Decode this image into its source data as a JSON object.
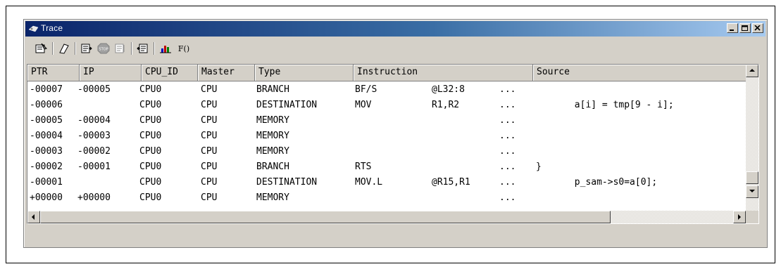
{
  "window": {
    "title": "Trace"
  },
  "toolbar": {
    "buttons": [
      "properties-icon",
      "clear-icon",
      "acquisition-icon",
      "stop-icon",
      "trace-find-icon",
      "save-icon",
      "statistics-icon",
      "function-call-icon"
    ],
    "function_call_label": "F()"
  },
  "table": {
    "columns": [
      "PTR",
      "IP",
      "CPU_ID",
      "Master",
      "Type",
      "Instruction",
      "Source"
    ],
    "rows": [
      {
        "ptr": "-00007",
        "ip": "-00005",
        "cpu": "CPU0",
        "master": "CPU",
        "type": "BRANCH",
        "mnemonic": "BF/S",
        "operand": "@L32:8",
        "more": "...",
        "source": ""
      },
      {
        "ptr": "-00006",
        "ip": "",
        "cpu": "CPU0",
        "master": "CPU",
        "type": "DESTINATION",
        "mnemonic": "MOV",
        "operand": "R1,R2",
        "more": "...",
        "source": "       a[i] = tmp[9 - i];"
      },
      {
        "ptr": "-00005",
        "ip": "-00004",
        "cpu": "CPU0",
        "master": "CPU",
        "type": "MEMORY",
        "mnemonic": "",
        "operand": "",
        "more": "...",
        "source": ""
      },
      {
        "ptr": "-00004",
        "ip": "-00003",
        "cpu": "CPU0",
        "master": "CPU",
        "type": "MEMORY",
        "mnemonic": "",
        "operand": "",
        "more": "...",
        "source": ""
      },
      {
        "ptr": "-00003",
        "ip": "-00002",
        "cpu": "CPU0",
        "master": "CPU",
        "type": "MEMORY",
        "mnemonic": "",
        "operand": "",
        "more": "...",
        "source": ""
      },
      {
        "ptr": "-00002",
        "ip": "-00001",
        "cpu": "CPU0",
        "master": "CPU",
        "type": "BRANCH",
        "mnemonic": "RTS",
        "operand": "",
        "more": "...",
        "source": "}"
      },
      {
        "ptr": "-00001",
        "ip": "",
        "cpu": "CPU0",
        "master": "CPU",
        "type": "DESTINATION",
        "mnemonic": "MOV.L",
        "operand": "@R15,R1",
        "more": "...",
        "source": "       p_sam->s0=a[0];"
      },
      {
        "ptr": "+00000",
        "ip": "+00000",
        "cpu": "CPU0",
        "master": "CPU",
        "type": "MEMORY",
        "mnemonic": "",
        "operand": "",
        "more": "...",
        "source": ""
      }
    ]
  }
}
